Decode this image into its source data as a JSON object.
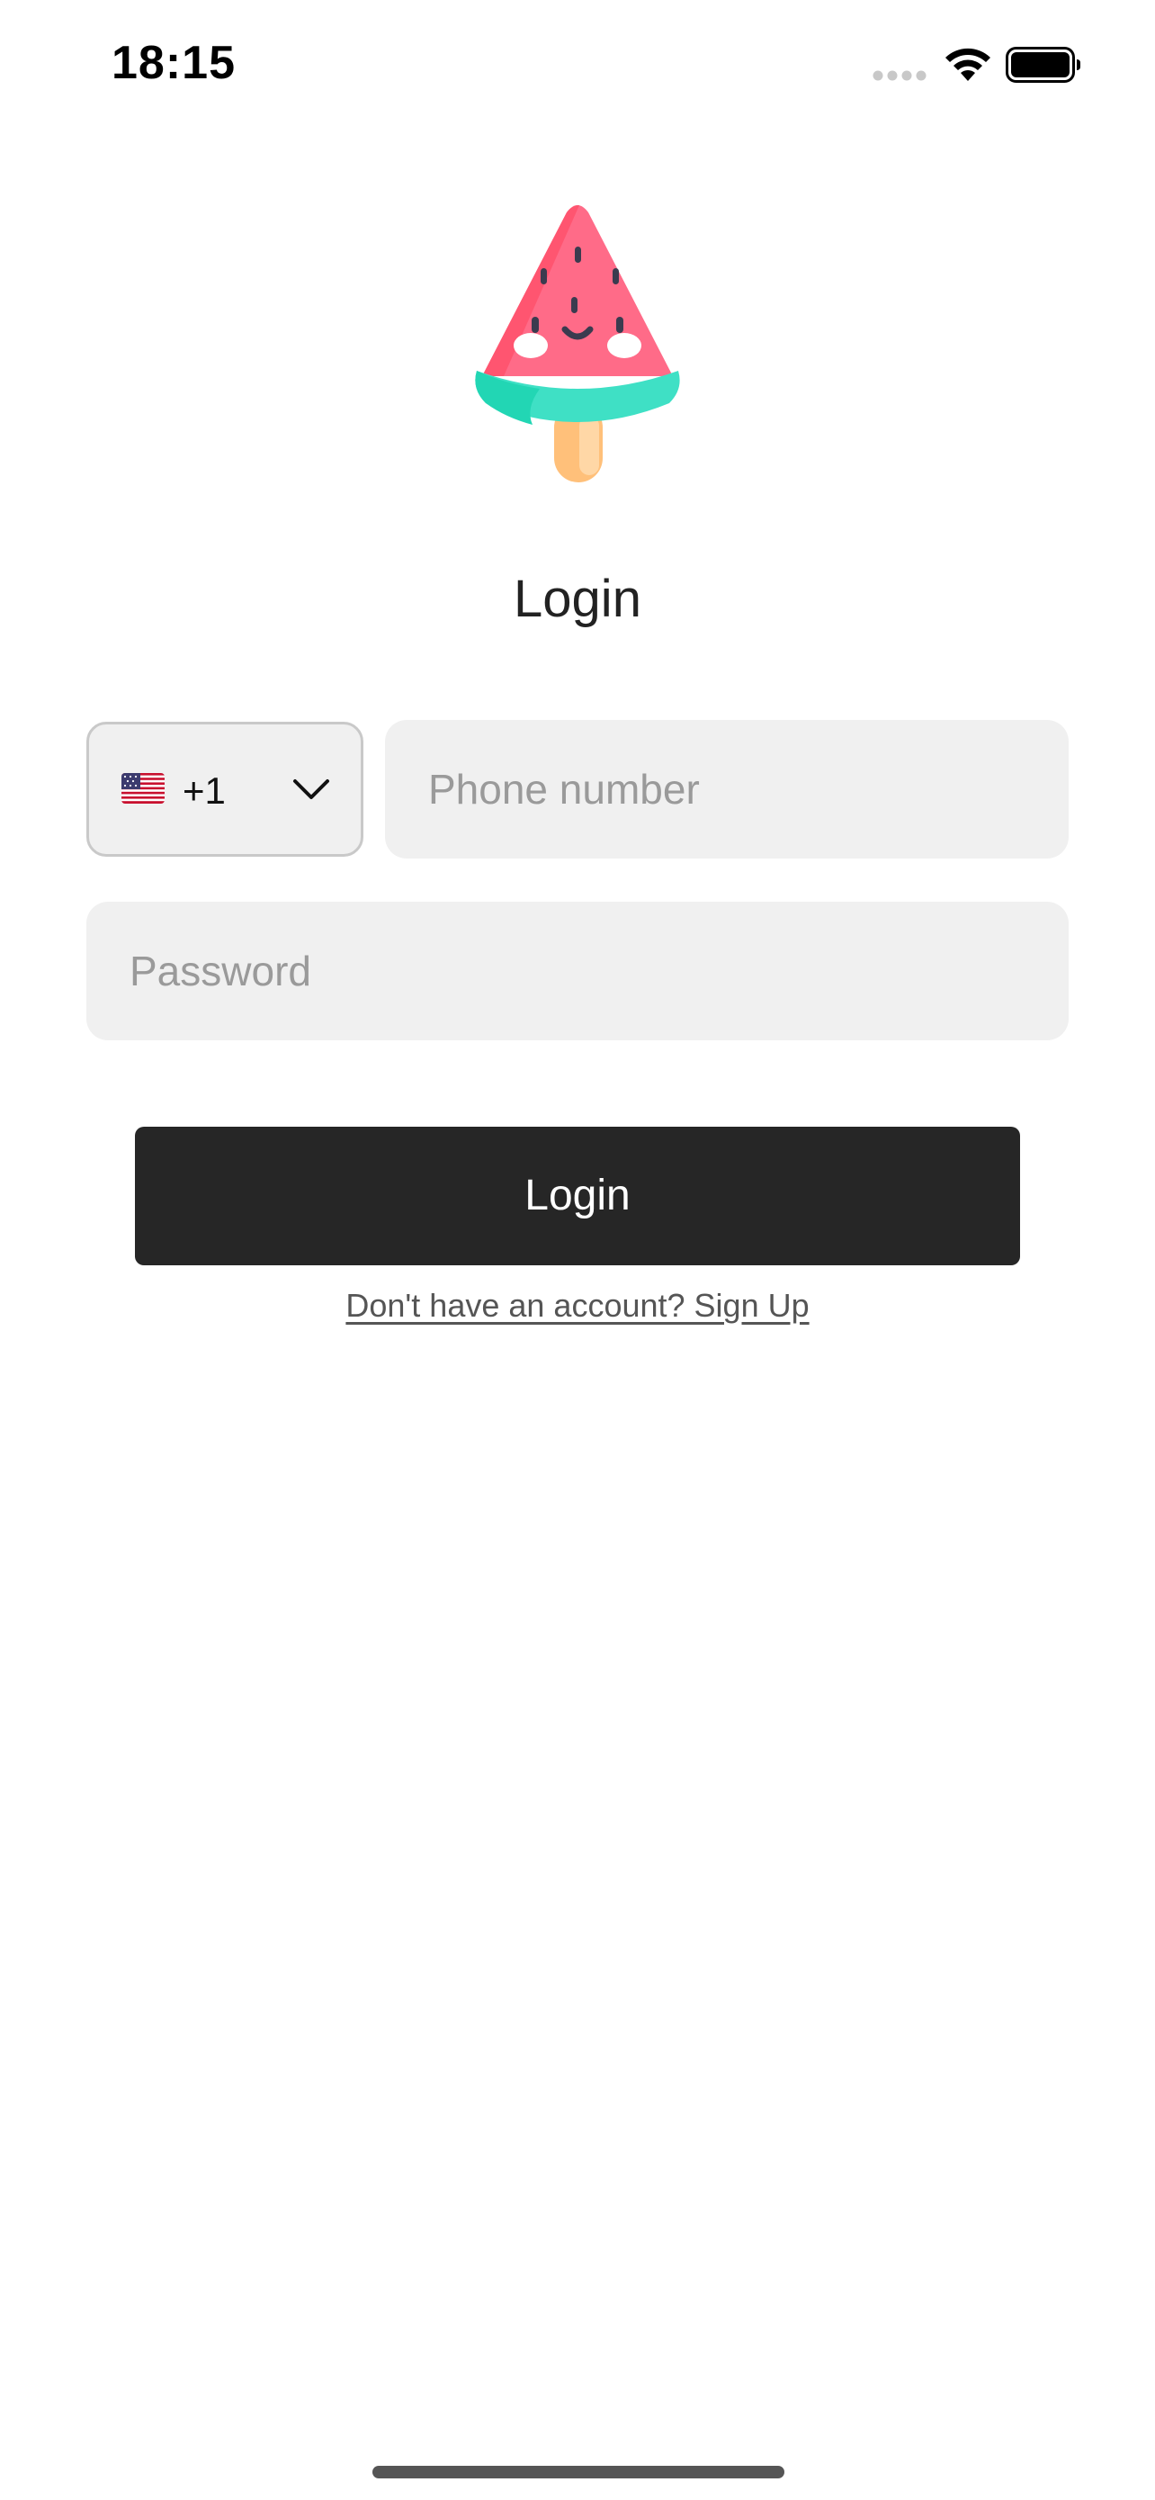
{
  "status_bar": {
    "time": "18:15",
    "icons": [
      "cellular-signal-icon",
      "wifi-icon",
      "battery-icon"
    ]
  },
  "logo": {
    "icon": "watermelon-popsicle-icon",
    "colors": {
      "flesh": "#ff6b88",
      "flesh_shade": "#ff5570",
      "rind": "#3fe0c5",
      "rind_shade": "#22d6b4",
      "stick": "#ffc07a",
      "stick_highlight": "#ffd7a6"
    }
  },
  "login": {
    "title": "Login",
    "country": {
      "flag_icon": "us-flag-icon",
      "dial_code": "+1"
    },
    "phone": {
      "placeholder": "Phone number",
      "value": ""
    },
    "password": {
      "placeholder": "Password",
      "value": ""
    },
    "submit_label": "Login",
    "signup_prompt": "Don't have an account? Sign Up"
  },
  "theme": {
    "button_bg": "#262626",
    "field_bg": "#f0f0f0",
    "placeholder": "#9a9a9a"
  }
}
